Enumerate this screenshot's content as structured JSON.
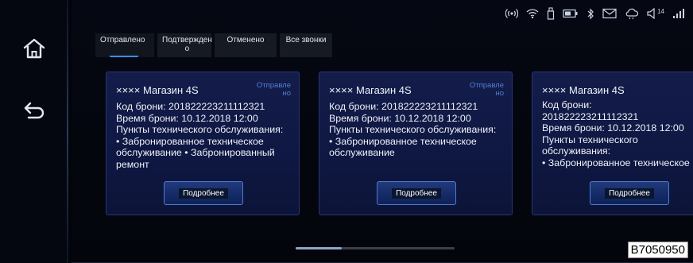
{
  "nav": {
    "home_icon": "home-icon",
    "back_icon": "back-arrow-icon"
  },
  "status_bar": {
    "icons": [
      "hotspot-icon",
      "wifi-icon",
      "usb-icon",
      "battery-icon",
      "bluetooth-icon",
      "message-icon",
      "cloud-icon",
      "volume-icon",
      "signal-icon"
    ],
    "volume_level": "14"
  },
  "tabs": [
    {
      "label": "Отправлено",
      "active": true
    },
    {
      "label": "Подтвержден о",
      "active": false
    },
    {
      "label": "Отменено",
      "active": false
    },
    {
      "label": "Все звонки",
      "active": false
    }
  ],
  "cards": [
    {
      "shop": "×××× Магазин 4S",
      "status": "Отправле но",
      "lines": [
        "Код брони: 201822223211112321",
        "Время брони: 10.12.2018 12:00",
        "Пункты технического обслуживания:",
        "• Забронированное техническое",
        "обслуживание • Забронированный",
        "ремонт"
      ],
      "button": "Подробнее"
    },
    {
      "shop": "×××× Магазин 4S",
      "status": "Отправле но",
      "lines": [
        "Код брони: 201822223211112321",
        "Время брони: 10.12.2018 12:00",
        "Пункты технического обслуживания:",
        "• Забронированное техническое",
        "обслуживание"
      ],
      "button": "Подробнее"
    },
    {
      "shop": "×××× Магазин 4S",
      "status": "",
      "lines": [
        "Код брони:",
        "201822223211112321",
        "Время брони: 10.12.2018 12:00",
        "Пункты технического",
        "обслуживания:",
        "• Забронированное техническое"
      ],
      "button": "Подробнее"
    }
  ],
  "figure_code": "B7050950",
  "colors": {
    "accent": "#3c8eff",
    "card_bg": "#111a45",
    "status_text": "#4f7fd8"
  }
}
